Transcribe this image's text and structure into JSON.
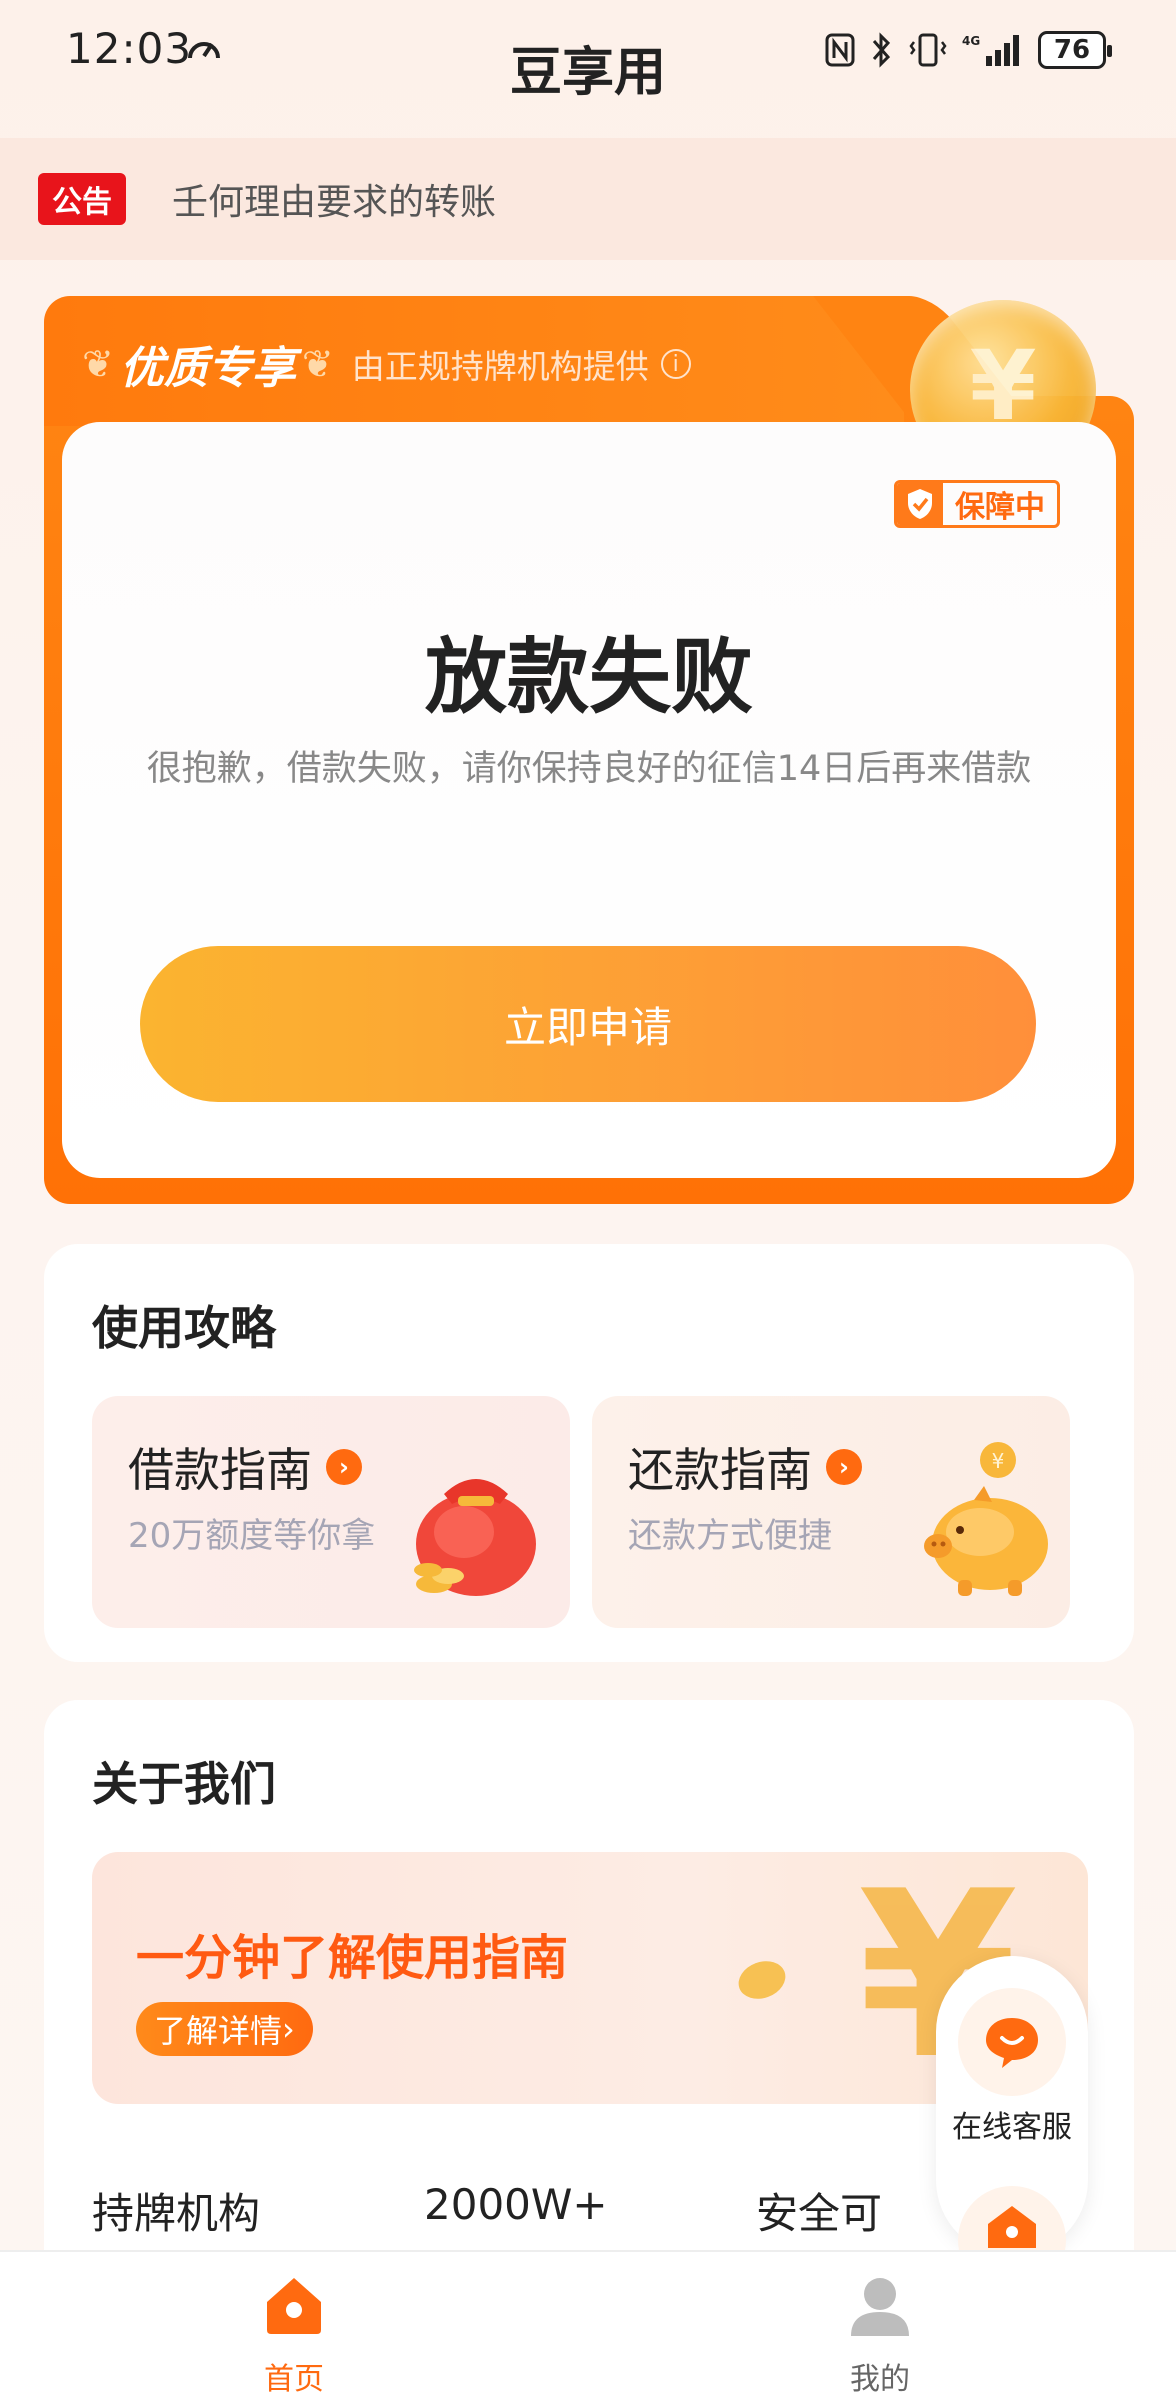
{
  "status_bar": {
    "time": "12:03",
    "battery": "76"
  },
  "app": {
    "title": "豆享用"
  },
  "notice": {
    "tag": "公告",
    "text": "壬何理由要求的转账"
  },
  "promo": {
    "badge_title": "优质专享",
    "subtitle": "由正规持牌机构提供",
    "guarantee_label": "保障中",
    "status_title": "放款失败",
    "status_desc": "很抱歉，借款失败，请你保持良好的征信14日后再来借款",
    "apply_button": "立即申请",
    "coin_symbol": "¥"
  },
  "guide": {
    "title": "使用攻略",
    "items": [
      {
        "name": "借款指南",
        "desc": "20万额度等你拿"
      },
      {
        "name": "还款指南",
        "desc": "还款方式便捷"
      }
    ]
  },
  "about": {
    "title": "关于我们",
    "banner_title": "一分钟了解使用指南",
    "banner_button": "了解详情",
    "banner_symbol": "¥",
    "stats": [
      "持牌机构",
      "2000W+",
      "安全可"
    ]
  },
  "float_service": {
    "label": "在线客服"
  },
  "tabbar": {
    "items": [
      {
        "label": "首页",
        "active": true
      },
      {
        "label": "我的",
        "active": false
      }
    ]
  },
  "colors": {
    "accent": "#ff6a10",
    "notice_tag": "#e8141b",
    "button_start": "#fbb430",
    "button_end": "#ff8f3a"
  }
}
